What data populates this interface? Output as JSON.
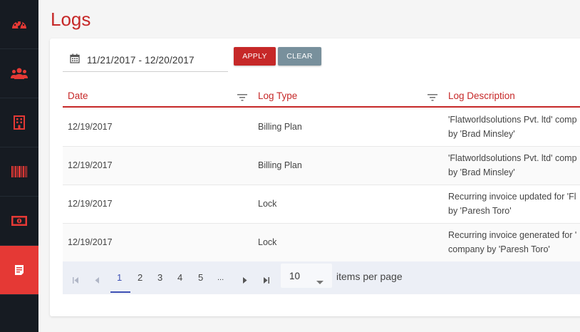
{
  "page": {
    "title": "Logs"
  },
  "sidebar": {
    "items": [
      {
        "icon": "dashboard-icon",
        "active": false
      },
      {
        "icon": "users-icon",
        "active": false
      },
      {
        "icon": "building-icon",
        "active": false
      },
      {
        "icon": "barcode-icon",
        "active": false
      },
      {
        "icon": "money-icon",
        "active": false
      },
      {
        "icon": "logs-icon",
        "active": true
      }
    ]
  },
  "colors": {
    "accent": "#c62828",
    "sidebar_bg": "#161b22",
    "active_item": "#e53935",
    "clear_button": "#78909c",
    "pager_active": "#3f51b5"
  },
  "filter": {
    "date_range": "11/21/2017 - 12/20/2017",
    "apply_label": "APPLY",
    "clear_label": "CLEAR"
  },
  "table": {
    "columns": [
      "Date",
      "Log Type",
      "Log Description"
    ],
    "rows": [
      {
        "date": "12/19/2017",
        "type": "Billing Plan",
        "desc1": "'Flatworldsolutions Pvt. ltd' comp",
        "desc2": "by 'Brad Minsley'"
      },
      {
        "date": "12/19/2017",
        "type": "Billing Plan",
        "desc1": "'Flatworldsolutions Pvt. ltd' comp",
        "desc2": "by 'Brad Minsley'"
      },
      {
        "date": "12/19/2017",
        "type": "Lock",
        "desc1": "Recurring invoice updated for 'Fl",
        "desc2": "by 'Paresh Toro'"
      },
      {
        "date": "12/19/2017",
        "type": "Lock",
        "desc1": "Recurring invoice generated for '",
        "desc2": "company by 'Paresh Toro'"
      }
    ]
  },
  "pager": {
    "pages": [
      "1",
      "2",
      "3",
      "4",
      "5",
      "..."
    ],
    "current": "1",
    "per_page": "10",
    "per_page_label": "items per page"
  }
}
